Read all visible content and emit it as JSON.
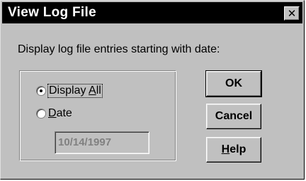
{
  "window": {
    "title": "View Log File",
    "close_glyph": "✕",
    "close_icon": "close-icon"
  },
  "prompt": "Display log file entries starting with date:",
  "options": {
    "display_all": {
      "pre": "Display ",
      "accel": "A",
      "post": "ll",
      "selected": true
    },
    "date": {
      "pre": "",
      "accel": "D",
      "post": "ate",
      "selected": false
    }
  },
  "date_field": {
    "value": "10/14/1997",
    "enabled": false
  },
  "buttons": {
    "ok": "OK",
    "cancel": "Cancel",
    "help": {
      "pre": "",
      "accel": "H",
      "post": "elp"
    }
  },
  "colors": {
    "face": "#c0c0c0",
    "titlebar": "#000000",
    "disabled_text": "#808080"
  }
}
